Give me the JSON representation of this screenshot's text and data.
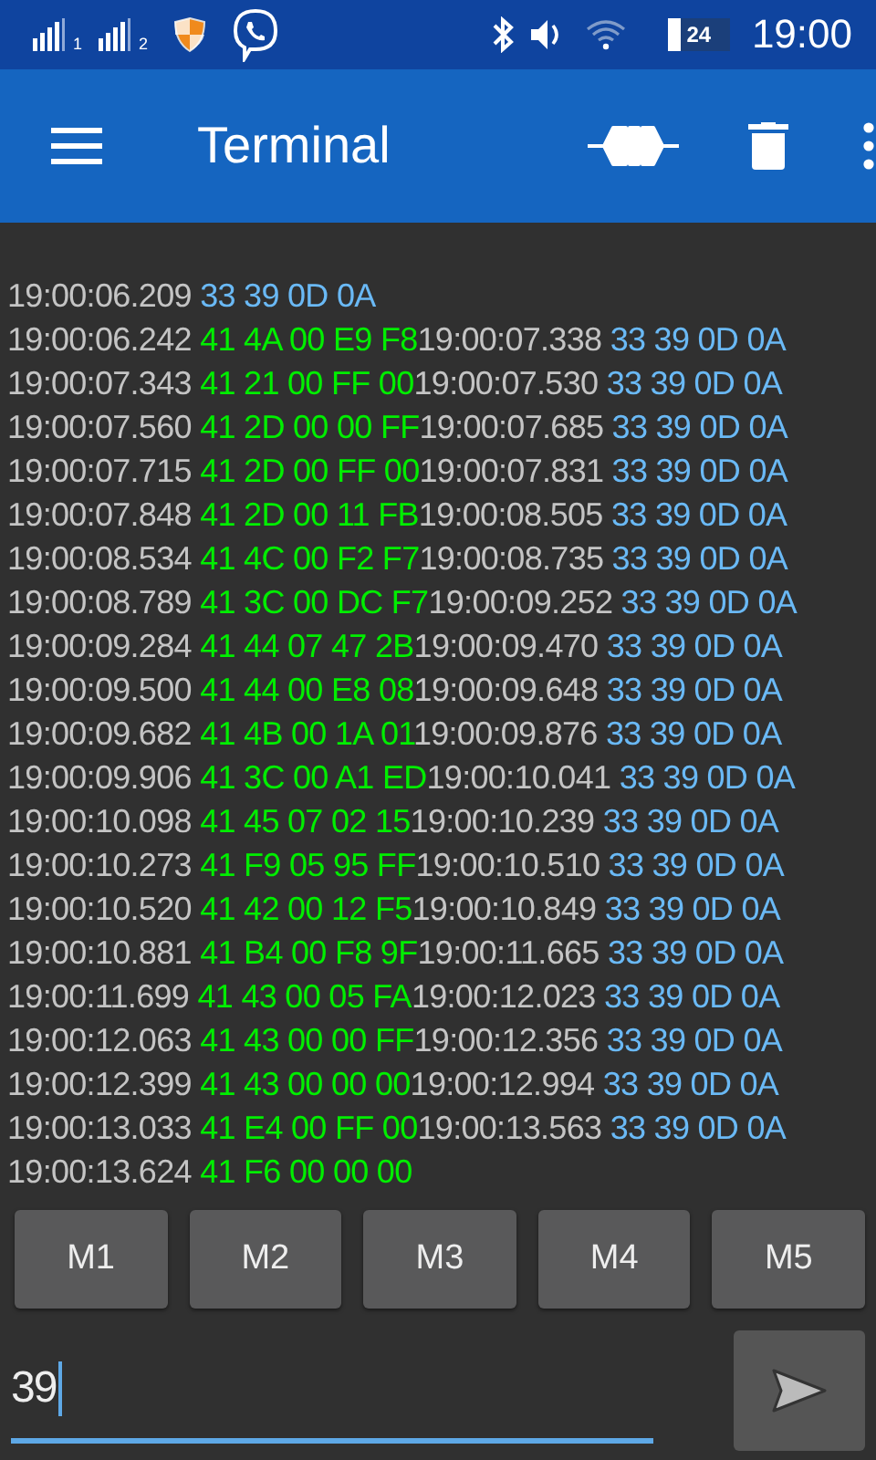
{
  "status_bar": {
    "sim_labels": [
      "1",
      "2"
    ],
    "battery": "24",
    "time": "19:00"
  },
  "app_bar": {
    "title": "Terminal"
  },
  "terminal": {
    "lines": [
      [
        {
          "kind": "time",
          "text": "19:00:06.209"
        },
        {
          "kind": "rx",
          "text": "33 39 0D 0A"
        }
      ],
      [
        {
          "kind": "time",
          "text": "19:00:06.242"
        },
        {
          "kind": "tx",
          "text": "41 4A 00 E9 F8"
        },
        {
          "kind": "time",
          "text": "19:00:07.338"
        },
        {
          "kind": "rx",
          "text": "33 39 0D 0A"
        }
      ],
      [
        {
          "kind": "time",
          "text": "19:00:07.343"
        },
        {
          "kind": "tx",
          "text": "41 21 00 FF 00"
        },
        {
          "kind": "time",
          "text": "19:00:07.530"
        },
        {
          "kind": "rx",
          "text": "33 39 0D 0A"
        }
      ],
      [
        {
          "kind": "time",
          "text": "19:00:07.560"
        },
        {
          "kind": "tx",
          "text": "41 2D 00 00 FF"
        },
        {
          "kind": "time",
          "text": "19:00:07.685"
        },
        {
          "kind": "rx",
          "text": "33 39 0D 0A"
        }
      ],
      [
        {
          "kind": "time",
          "text": "19:00:07.715"
        },
        {
          "kind": "tx",
          "text": "41 2D 00 FF 00"
        },
        {
          "kind": "time",
          "text": "19:00:07.831"
        },
        {
          "kind": "rx",
          "text": "33 39 0D 0A"
        }
      ],
      [
        {
          "kind": "time",
          "text": "19:00:07.848"
        },
        {
          "kind": "tx",
          "text": "41 2D 00 11 FB"
        },
        {
          "kind": "time",
          "text": "19:00:08.505"
        },
        {
          "kind": "rx",
          "text": "33 39 0D 0A"
        }
      ],
      [
        {
          "kind": "time",
          "text": "19:00:08.534"
        },
        {
          "kind": "tx",
          "text": "41 4C 00 F2 F7"
        },
        {
          "kind": "time",
          "text": "19:00:08.735"
        },
        {
          "kind": "rx",
          "text": "33 39 0D 0A"
        }
      ],
      [
        {
          "kind": "time",
          "text": "19:00:08.789"
        },
        {
          "kind": "tx",
          "text": "41 3C 00 DC F7"
        },
        {
          "kind": "time",
          "text": "19:00:09.252"
        },
        {
          "kind": "rx",
          "text": "33 39 0D 0A"
        }
      ],
      [
        {
          "kind": "time",
          "text": "19:00:09.284"
        },
        {
          "kind": "tx",
          "text": "41 44 07 47 2B"
        },
        {
          "kind": "time",
          "text": "19:00:09.470"
        },
        {
          "kind": "rx",
          "text": "33 39 0D 0A"
        }
      ],
      [
        {
          "kind": "time",
          "text": "19:00:09.500"
        },
        {
          "kind": "tx",
          "text": "41 44 00 E8 08"
        },
        {
          "kind": "time",
          "text": "19:00:09.648"
        },
        {
          "kind": "rx",
          "text": "33 39 0D 0A"
        }
      ],
      [
        {
          "kind": "time",
          "text": "19:00:09.682"
        },
        {
          "kind": "tx",
          "text": "41 4B 00 1A 01"
        },
        {
          "kind": "time",
          "text": "19:00:09.876"
        },
        {
          "kind": "rx",
          "text": "33 39 0D 0A"
        }
      ],
      [
        {
          "kind": "time",
          "text": "19:00:09.906"
        },
        {
          "kind": "tx",
          "text": "41 3C 00 A1 ED"
        },
        {
          "kind": "time",
          "text": "19:00:10.041"
        },
        {
          "kind": "rx",
          "text": "33 39 0D 0A"
        }
      ],
      [
        {
          "kind": "time",
          "text": "19:00:10.098"
        },
        {
          "kind": "tx",
          "text": "41 45 07 02 15"
        },
        {
          "kind": "time",
          "text": "19:00:10.239"
        },
        {
          "kind": "rx",
          "text": "33 39 0D 0A"
        }
      ],
      [
        {
          "kind": "time",
          "text": "19:00:10.273"
        },
        {
          "kind": "tx",
          "text": "41 F9 05 95 FF"
        },
        {
          "kind": "time",
          "text": "19:00:10.510"
        },
        {
          "kind": "rx",
          "text": "33 39 0D 0A"
        }
      ],
      [
        {
          "kind": "time",
          "text": "19:00:10.520"
        },
        {
          "kind": "tx",
          "text": "41 42 00 12 F5"
        },
        {
          "kind": "time",
          "text": "19:00:10.849"
        },
        {
          "kind": "rx",
          "text": "33 39 0D 0A"
        }
      ],
      [
        {
          "kind": "time",
          "text": "19:00:10.881"
        },
        {
          "kind": "tx",
          "text": "41 B4 00 F8 9F"
        },
        {
          "kind": "time",
          "text": "19:00:11.665"
        },
        {
          "kind": "rx",
          "text": "33 39 0D 0A"
        }
      ],
      [
        {
          "kind": "time",
          "text": "19:00:11.699"
        },
        {
          "kind": "tx",
          "text": "41 43 00 05 FA"
        },
        {
          "kind": "time",
          "text": "19:00:12.023"
        },
        {
          "kind": "rx",
          "text": "33 39 0D 0A"
        }
      ],
      [
        {
          "kind": "time",
          "text": "19:00:12.063"
        },
        {
          "kind": "tx",
          "text": "41 43 00 00 FF"
        },
        {
          "kind": "time",
          "text": "19:00:12.356"
        },
        {
          "kind": "rx",
          "text": "33 39 0D 0A"
        }
      ],
      [
        {
          "kind": "time",
          "text": "19:00:12.399"
        },
        {
          "kind": "tx",
          "text": "41 43 00 00 00"
        },
        {
          "kind": "time",
          "text": "19:00:12.994"
        },
        {
          "kind": "rx",
          "text": "33 39 0D 0A"
        }
      ],
      [
        {
          "kind": "time",
          "text": "19:00:13.033"
        },
        {
          "kind": "tx",
          "text": "41 E4 00 FF 00"
        },
        {
          "kind": "time",
          "text": "19:00:13.563"
        },
        {
          "kind": "rx",
          "text": "33 39 0D 0A"
        }
      ],
      [
        {
          "kind": "time",
          "text": "19:00:13.624"
        },
        {
          "kind": "tx",
          "text": "41 F6 00 00 00"
        }
      ]
    ]
  },
  "macros": [
    "M1",
    "M2",
    "M3",
    "M4",
    "M5"
  ],
  "input": {
    "value": "39",
    "focused": true
  }
}
